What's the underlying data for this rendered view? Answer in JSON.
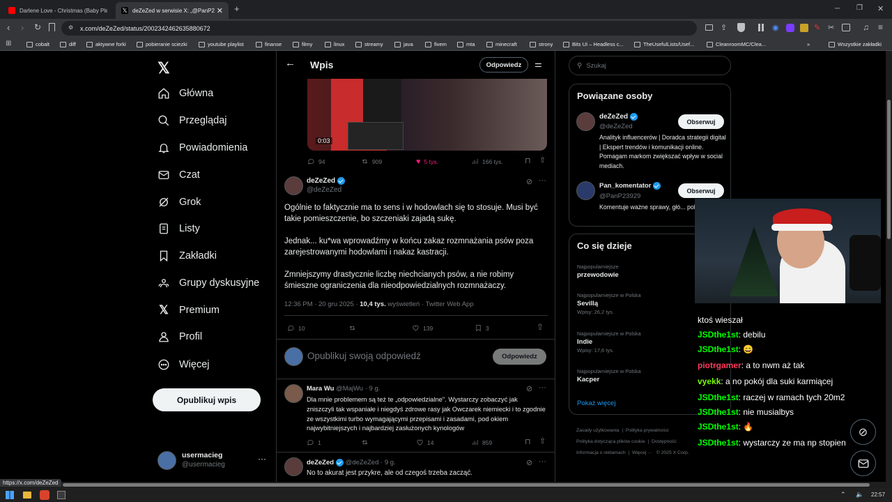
{
  "browser": {
    "tabs": [
      {
        "title": "Darlene Love - Christmas (Baby Plea..."
      },
      {
        "title": "deZeZed w serwisie X: „@PanP2...",
        "close": "✕"
      }
    ],
    "new_tab": "+",
    "url": "x.com/deZeZed/status/2002342462635880672",
    "bookmarks": [
      "cobalt",
      "diff",
      "aktywne forki",
      "pobieranie sciezki",
      "youtube playlist",
      "finanse",
      "filmy",
      "linux",
      "streamy",
      "java",
      "fivem",
      "mta",
      "minecraft",
      "strony",
      "Bits UI – Headless c...",
      "TheUsefulLists/Usef...",
      "CleanroomMC/Clea..."
    ],
    "bookmarks_more": "»",
    "all_bookmarks": "Wszystkie zakładki",
    "status_url": "https://x.com/deZeZed"
  },
  "sidebar": {
    "items": [
      {
        "label": "Główna"
      },
      {
        "label": "Przeglądaj"
      },
      {
        "label": "Powiadomienia"
      },
      {
        "label": "Czat"
      },
      {
        "label": "Grok"
      },
      {
        "label": "Listy"
      },
      {
        "label": "Zakładki"
      },
      {
        "label": "Grupy dyskusyjne"
      },
      {
        "label": "Premium"
      },
      {
        "label": "Profil"
      },
      {
        "label": "Więcej"
      }
    ],
    "post_button": "Opublikuj wpis",
    "account": {
      "name": "usermacieg",
      "handle": "@usermacieg",
      "more": "···"
    }
  },
  "header": {
    "title": "Wpis",
    "reply_button": "Odpowiedz"
  },
  "video": {
    "time": "0:03"
  },
  "prev_stats": {
    "replies": "94",
    "reposts": "909",
    "likes": "5 tys.",
    "views": "166 tys."
  },
  "main_post": {
    "name": "deZeZed",
    "handle": "@deZeZed",
    "paragraphs": [
      "Ogólnie to faktycznie ma to sens i w hodowlach się to stosuje. Musi być takie pomieszczenie, bo szczeniaki zajadą sukę.",
      "Jednak... ku*wa wprowadźmy w końcu zakaz rozmnażania psów poza zarejestrowanymi hodowlami i nakaz kastracji.",
      "Zmniejszymy drastycznie liczbę niechcianych psów, a nie robimy śmieszne ograniczenia dla nieodpowiedzialnych rozmnażaczy."
    ],
    "meta_time": "12:36 PM · 20 gru 2025 · ",
    "meta_views": "10,4 tys.",
    "meta_suffix": " wyświetleń · Twitter Web App",
    "replies": "10",
    "likes": "139",
    "bookmarks": "3"
  },
  "reply_box": {
    "placeholder": "Opublikuj swoją odpowiedź",
    "button": "Odpowiedz"
  },
  "replies": [
    {
      "name": "Mara Wu",
      "handle": "@MajWu · 9 g.",
      "text": "Dla mnie problemem są też te „odpowiedzialne\". Wystarczy zobaczyć jak zniszczyli tak wspaniałe i niegdyś zdrowe rasy jak Owczarek niemiecki i to zgodnie ze wszystkimi turbo wymagającymi przepisami i zasadami, pod okiem najwybitniejszych i najbardziej zasłużonych kynologów",
      "replies": "1",
      "likes": "14",
      "views": "859"
    },
    {
      "name": "deZeZed",
      "handle": "@deZeZed · 9 g.",
      "text": "No to akurat jest przykre, ale od czegoś trzeba zacząć."
    }
  ],
  "search": {
    "placeholder": "Szukaj"
  },
  "related": {
    "title": "Powiązane osoby",
    "people": [
      {
        "name": "deZeZed",
        "handle": "@deZeZed",
        "follow": "Obserwuj",
        "bio": "Analityk influencerów | Doradca strategii digital | Ekspert trendów i komunikacji online. Pomagam markom zwiększać wpływ w social mediach."
      },
      {
        "name": "Pan_komentator",
        "handle": "@PanP23929",
        "follow": "Obserwuj",
        "bio": "Komentuje ważne sprawy, głó... politykę ale czasem i inne tem..."
      }
    ]
  },
  "trends": {
    "title": "Co się dzieje",
    "items": [
      {
        "category": "Najpopularniejsze",
        "name": "przewodowie",
        "count": ""
      },
      {
        "category": "Najpopularniejsze w Polska",
        "name": "Sevillą",
        "count": "Wpisy: 26,2 tys."
      },
      {
        "category": "Najpopularniejsze w Polska",
        "name": "Indie",
        "count": "Wpisy: 17,6 tys."
      },
      {
        "category": "Najpopularniejsze w Polska",
        "name": "Kacper",
        "count": ""
      }
    ],
    "show_more": "Pokaż więcej"
  },
  "footer_links": [
    "Zasady użytkowania",
    "Polityka prywatności",
    "Polityka dotycząca plików cookie",
    "Dostępność",
    "Informacja o reklamach",
    "Więcej ···",
    "© 2025 X Corp."
  ],
  "chat": [
    {
      "user": "",
      "text": "ktoś wieszał",
      "color": "#ffffff"
    },
    {
      "user": "JSDthe1st",
      "text": ": debilu",
      "color": "#00ff00"
    },
    {
      "user": "JSDthe1st",
      "text": ": 😄",
      "color": "#00ff00"
    },
    {
      "user": "piotrgamer",
      "text": ": a to nwm aż tak",
      "color": "#ff3b5c"
    },
    {
      "user": "vyekk",
      "text": ": a no pokój dla suki karmiącej",
      "color": "#7cfc00"
    },
    {
      "user": "JSDthe1st",
      "text": ": raczej w ramach tych 20m2",
      "color": "#00ff00"
    },
    {
      "user": "JSDthe1st",
      "text": ": nie musialbys",
      "color": "#00ff00"
    },
    {
      "user": "JSDthe1st",
      "text": ": 🔥",
      "color": "#00ff00"
    },
    {
      "user": "JSDthe1st",
      "text": ": wystarczy ze ma np stopien",
      "color": "#00ff00"
    }
  ],
  "taskbar": {
    "time": "22:57"
  }
}
